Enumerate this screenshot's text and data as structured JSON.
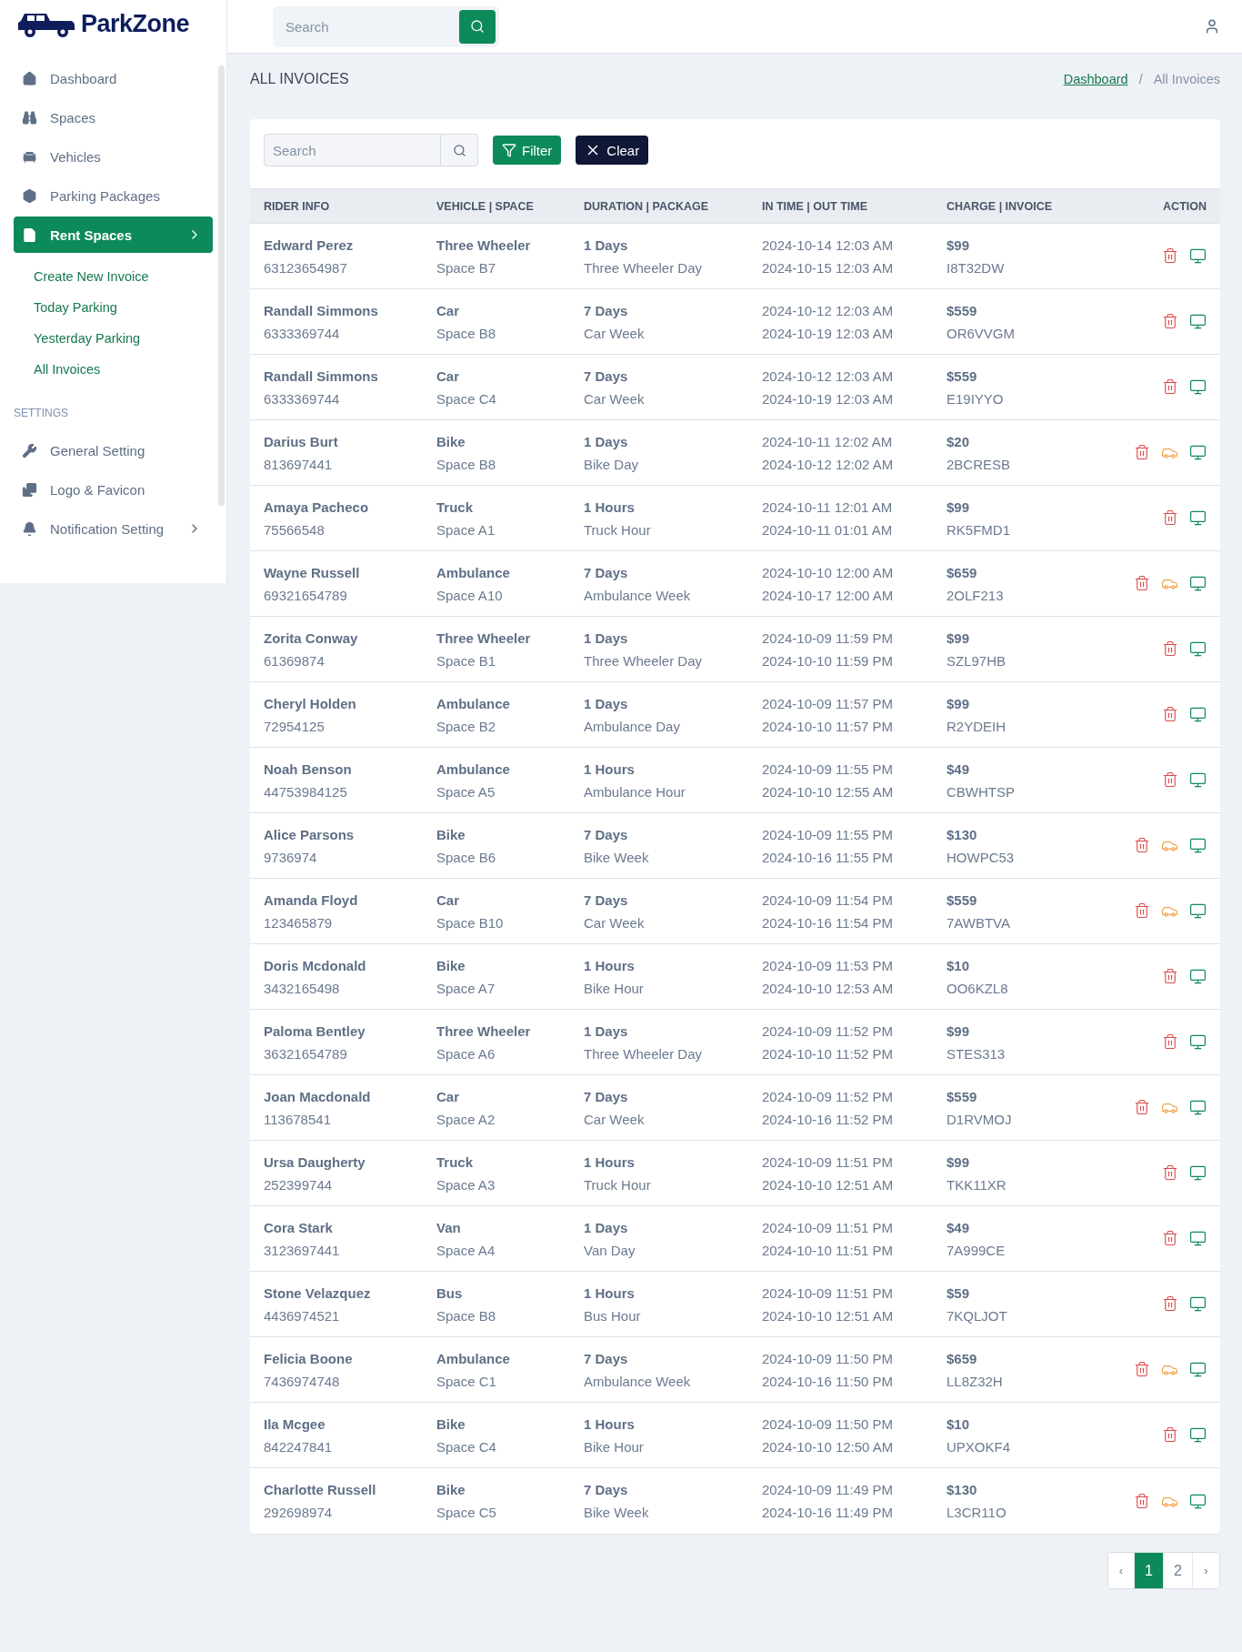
{
  "brand": {
    "name": "ParkZone"
  },
  "sidebar": {
    "items": [
      {
        "label": "Dashboard",
        "selected": false,
        "expandable": false
      },
      {
        "label": "Spaces",
        "selected": false,
        "expandable": false
      },
      {
        "label": "Vehicles",
        "selected": false,
        "expandable": false
      },
      {
        "label": "Parking Packages",
        "selected": false,
        "expandable": false
      },
      {
        "label": "Rent Spaces",
        "selected": true,
        "expandable": true,
        "children": [
          {
            "label": "Create New Invoice"
          },
          {
            "label": "Today Parking"
          },
          {
            "label": "Yesterday Parking"
          },
          {
            "label": "All Invoices"
          }
        ]
      }
    ],
    "section": "SETTINGS",
    "settings": [
      {
        "label": "General Setting",
        "selected": false,
        "expandable": false
      },
      {
        "label": "Logo & Favicon",
        "selected": false,
        "expandable": false
      },
      {
        "label": "Notification Setting",
        "selected": false,
        "expandable": true
      }
    ]
  },
  "topbar": {
    "search": {
      "placeholder": "Search"
    }
  },
  "page": {
    "title": "ALL INVOICES",
    "breadcrumb": [
      {
        "label": "Dashboard",
        "link": true
      },
      {
        "label": "All Invoices",
        "link": false
      }
    ],
    "separator": "/"
  },
  "toolbar": {
    "search": {
      "placeholder": "Search"
    },
    "filter": "Filter",
    "clear": "Clear"
  },
  "table": {
    "columns": [
      "RIDER INFO",
      "VEHICLE | SPACE",
      "DURATION | PACKAGE",
      "IN TIME | OUT TIME",
      "CHARGE | INVOICE",
      "ACTION"
    ],
    "rows": [
      {
        "name": "Edward Perez",
        "phone": "63123654987",
        "vehicle": "Three Wheeler",
        "space": "Space B7",
        "duration": "1 Days",
        "package": "Three Wheeler Day",
        "in": "2024-10-14 12:03 AM",
        "out": "2024-10-15 12:03 AM",
        "charge": "$99",
        "invoice": "I8T32DW",
        "parked": false
      },
      {
        "name": "Randall Simmons",
        "phone": "6333369744",
        "vehicle": "Car",
        "space": "Space B8",
        "duration": "7 Days",
        "package": "Car Week",
        "in": "2024-10-12 12:03 AM",
        "out": "2024-10-19 12:03 AM",
        "charge": "$559",
        "invoice": "OR6VVGM",
        "parked": false
      },
      {
        "name": "Randall Simmons",
        "phone": "6333369744",
        "vehicle": "Car",
        "space": "Space C4",
        "duration": "7 Days",
        "package": "Car Week",
        "in": "2024-10-12 12:03 AM",
        "out": "2024-10-19 12:03 AM",
        "charge": "$559",
        "invoice": "E19IYYO",
        "parked": false
      },
      {
        "name": "Darius Burt",
        "phone": "813697441",
        "vehicle": "Bike",
        "space": "Space B8",
        "duration": "1 Days",
        "package": "Bike Day",
        "in": "2024-10-11 12:02 AM",
        "out": "2024-10-12 12:02 AM",
        "charge": "$20",
        "invoice": "2BCRESB",
        "parked": true
      },
      {
        "name": "Amaya Pacheco",
        "phone": "75566548",
        "vehicle": "Truck",
        "space": "Space A1",
        "duration": "1 Hours",
        "package": "Truck Hour",
        "in": "2024-10-11 12:01 AM",
        "out": "2024-10-11 01:01 AM",
        "charge": "$99",
        "invoice": "RK5FMD1",
        "parked": false
      },
      {
        "name": "Wayne Russell",
        "phone": "69321654789",
        "vehicle": "Ambulance",
        "space": "Space A10",
        "duration": "7 Days",
        "package": "Ambulance Week",
        "in": "2024-10-10 12:00 AM",
        "out": "2024-10-17 12:00 AM",
        "charge": "$659",
        "invoice": "2OLF213",
        "parked": true
      },
      {
        "name": "Zorita Conway",
        "phone": "61369874",
        "vehicle": "Three Wheeler",
        "space": "Space B1",
        "duration": "1 Days",
        "package": "Three Wheeler Day",
        "in": "2024-10-09 11:59 PM",
        "out": "2024-10-10 11:59 PM",
        "charge": "$99",
        "invoice": "SZL97HB",
        "parked": false
      },
      {
        "name": "Cheryl Holden",
        "phone": "72954125",
        "vehicle": "Ambulance",
        "space": "Space B2",
        "duration": "1 Days",
        "package": "Ambulance Day",
        "in": "2024-10-09 11:57 PM",
        "out": "2024-10-10 11:57 PM",
        "charge": "$99",
        "invoice": "R2YDEIH",
        "parked": false
      },
      {
        "name": "Noah Benson",
        "phone": "44753984125",
        "vehicle": "Ambulance",
        "space": "Space A5",
        "duration": "1 Hours",
        "package": "Ambulance Hour",
        "in": "2024-10-09 11:55 PM",
        "out": "2024-10-10 12:55 AM",
        "charge": "$49",
        "invoice": "CBWHTSP",
        "parked": false
      },
      {
        "name": "Alice Parsons",
        "phone": "9736974",
        "vehicle": "Bike",
        "space": "Space B6",
        "duration": "7 Days",
        "package": "Bike Week",
        "in": "2024-10-09 11:55 PM",
        "out": "2024-10-16 11:55 PM",
        "charge": "$130",
        "invoice": "HOWPC53",
        "parked": true
      },
      {
        "name": "Amanda Floyd",
        "phone": "123465879",
        "vehicle": "Car",
        "space": "Space B10",
        "duration": "7 Days",
        "package": "Car Week",
        "in": "2024-10-09 11:54 PM",
        "out": "2024-10-16 11:54 PM",
        "charge": "$559",
        "invoice": "7AWBTVA",
        "parked": true
      },
      {
        "name": "Doris Mcdonald",
        "phone": "3432165498",
        "vehicle": "Bike",
        "space": "Space A7",
        "duration": "1 Hours",
        "package": "Bike Hour",
        "in": "2024-10-09 11:53 PM",
        "out": "2024-10-10 12:53 AM",
        "charge": "$10",
        "invoice": "OO6KZL8",
        "parked": false
      },
      {
        "name": "Paloma Bentley",
        "phone": "36321654789",
        "vehicle": "Three Wheeler",
        "space": "Space A6",
        "duration": "1 Days",
        "package": "Three Wheeler Day",
        "in": "2024-10-09 11:52 PM",
        "out": "2024-10-10 11:52 PM",
        "charge": "$99",
        "invoice": "STES313",
        "parked": false
      },
      {
        "name": "Joan Macdonald",
        "phone": "113678541",
        "vehicle": "Car",
        "space": "Space A2",
        "duration": "7 Days",
        "package": "Car Week",
        "in": "2024-10-09 11:52 PM",
        "out": "2024-10-16 11:52 PM",
        "charge": "$559",
        "invoice": "D1RVMOJ",
        "parked": true
      },
      {
        "name": "Ursa Daugherty",
        "phone": "252399744",
        "vehicle": "Truck",
        "space": "Space A3",
        "duration": "1 Hours",
        "package": "Truck Hour",
        "in": "2024-10-09 11:51 PM",
        "out": "2024-10-10 12:51 AM",
        "charge": "$99",
        "invoice": "TKK11XR",
        "parked": false
      },
      {
        "name": "Cora Stark",
        "phone": "3123697441",
        "vehicle": "Van",
        "space": "Space A4",
        "duration": "1 Days",
        "package": "Van Day",
        "in": "2024-10-09 11:51 PM",
        "out": "2024-10-10 11:51 PM",
        "charge": "$49",
        "invoice": "7A999CE",
        "parked": false
      },
      {
        "name": "Stone Velazquez",
        "phone": "4436974521",
        "vehicle": "Bus",
        "space": "Space B8",
        "duration": "1 Hours",
        "package": "Bus Hour",
        "in": "2024-10-09 11:51 PM",
        "out": "2024-10-10 12:51 AM",
        "charge": "$59",
        "invoice": "7KQLJOT",
        "parked": false
      },
      {
        "name": "Felicia Boone",
        "phone": "7436974748",
        "vehicle": "Ambulance",
        "space": "Space C1",
        "duration": "7 Days",
        "package": "Ambulance Week",
        "in": "2024-10-09 11:50 PM",
        "out": "2024-10-16 11:50 PM",
        "charge": "$659",
        "invoice": "LL8Z32H",
        "parked": true
      },
      {
        "name": "Ila Mcgee",
        "phone": "842247841",
        "vehicle": "Bike",
        "space": "Space C4",
        "duration": "1 Hours",
        "package": "Bike Hour",
        "in": "2024-10-09 11:50 PM",
        "out": "2024-10-10 12:50 AM",
        "charge": "$10",
        "invoice": "UPXOKF4",
        "parked": false
      },
      {
        "name": "Charlotte Russell",
        "phone": "292698974",
        "vehicle": "Bike",
        "space": "Space C5",
        "duration": "7 Days",
        "package": "Bike Week",
        "in": "2024-10-09 11:49 PM",
        "out": "2024-10-16 11:49 PM",
        "charge": "$130",
        "invoice": "L3CR11O",
        "parked": true
      }
    ]
  },
  "pagination": {
    "prev": "‹",
    "next": "›",
    "pages": [
      {
        "label": "1",
        "selected": true
      },
      {
        "label": "2",
        "selected": false
      }
    ]
  }
}
